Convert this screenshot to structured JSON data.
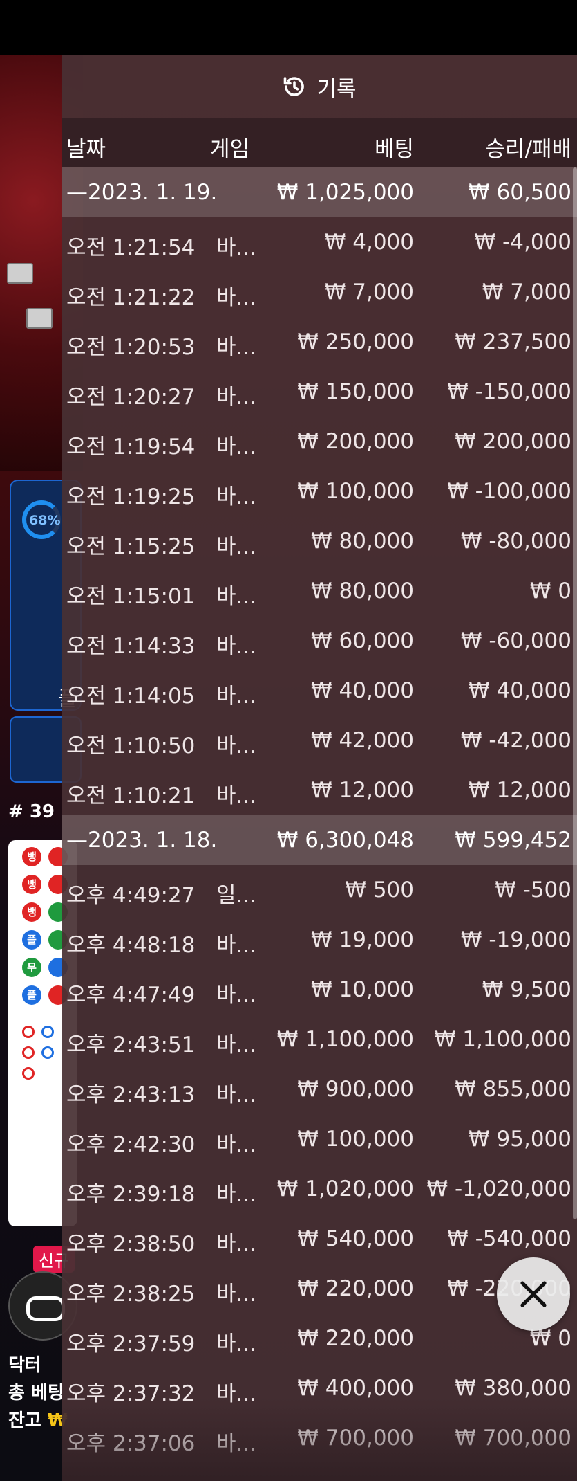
{
  "background": {
    "progress_label": "68%",
    "play_label": "플",
    "round_label": "# 39",
    "roadmap_chars": [
      "뱅",
      "뱅",
      "뱅",
      "플",
      "무",
      "플"
    ],
    "new_badge": "신규",
    "bottom_lines": [
      {
        "prefix": "닥터",
        "label": ""
      },
      {
        "prefix": "총 베팅",
        "label": ""
      },
      {
        "prefix": "잔고",
        "label": "₩"
      }
    ]
  },
  "history": {
    "title": "기록",
    "columns": {
      "date": "날짜",
      "game": "게임",
      "bet": "베팅",
      "result": "승리/패배"
    },
    "groups": [
      {
        "date": "—2023. 1. 19.",
        "bet": "₩ 1,025,000",
        "result": "₩ 60,500",
        "entries": [
          {
            "time": "오전 1:21:54",
            "game": "바...",
            "bet": "₩ 4,000",
            "result": "₩ -4,000"
          },
          {
            "time": "오전 1:21:22",
            "game": "바...",
            "bet": "₩ 7,000",
            "result": "₩ 7,000"
          },
          {
            "time": "오전 1:20:53",
            "game": "바...",
            "bet": "₩ 250,000",
            "result": "₩ 237,500"
          },
          {
            "time": "오전 1:20:27",
            "game": "바...",
            "bet": "₩ 150,000",
            "result": "₩ -150,000"
          },
          {
            "time": "오전 1:19:54",
            "game": "바...",
            "bet": "₩ 200,000",
            "result": "₩ 200,000"
          },
          {
            "time": "오전 1:19:25",
            "game": "바...",
            "bet": "₩ 100,000",
            "result": "₩ -100,000"
          },
          {
            "time": "오전 1:15:25",
            "game": "바...",
            "bet": "₩ 80,000",
            "result": "₩ -80,000"
          },
          {
            "time": "오전 1:15:01",
            "game": "바...",
            "bet": "₩ 80,000",
            "result": "₩ 0"
          },
          {
            "time": "오전 1:14:33",
            "game": "바...",
            "bet": "₩ 60,000",
            "result": "₩ -60,000"
          },
          {
            "time": "오전 1:14:05",
            "game": "바...",
            "bet": "₩ 40,000",
            "result": "₩ 40,000"
          },
          {
            "time": "오전 1:10:50",
            "game": "바...",
            "bet": "₩ 42,000",
            "result": "₩ -42,000"
          },
          {
            "time": "오전 1:10:21",
            "game": "바...",
            "bet": "₩ 12,000",
            "result": "₩ 12,000"
          }
        ]
      },
      {
        "date": "—2023. 1. 18.",
        "bet": "₩ 6,300,048",
        "result": "₩ 599,452",
        "entries": [
          {
            "time": "오후 4:49:27",
            "game": "일...",
            "bet": "₩ 500",
            "result": "₩ -500"
          },
          {
            "time": "오후 4:48:18",
            "game": "바...",
            "bet": "₩ 19,000",
            "result": "₩ -19,000"
          },
          {
            "time": "오후 4:47:49",
            "game": "바...",
            "bet": "₩ 10,000",
            "result": "₩ 9,500"
          },
          {
            "time": "오후 2:43:51",
            "game": "바...",
            "bet": "₩ 1,100,000",
            "result": "₩ 1,100,000"
          },
          {
            "time": "오후 2:43:13",
            "game": "바...",
            "bet": "₩ 900,000",
            "result": "₩ 855,000"
          },
          {
            "time": "오후 2:42:30",
            "game": "바...",
            "bet": "₩ 100,000",
            "result": "₩ 95,000"
          },
          {
            "time": "오후 2:39:18",
            "game": "바...",
            "bet": "₩ 1,020,000",
            "result": "₩ -1,020,000"
          },
          {
            "time": "오후 2:38:50",
            "game": "바...",
            "bet": "₩ 540,000",
            "result": "₩ -540,000"
          },
          {
            "time": "오후 2:38:25",
            "game": "바...",
            "bet": "₩ 220,000",
            "result": "₩ -220,000"
          },
          {
            "time": "오후 2:37:59",
            "game": "바...",
            "bet": "₩ 220,000",
            "result": "₩ 0"
          },
          {
            "time": "오후 2:37:32",
            "game": "바...",
            "bet": "₩ 400,000",
            "result": "₩ 380,000"
          },
          {
            "time": "오후 2:37:06",
            "game": "바...",
            "bet": "₩ 700,000",
            "result": "₩ 700,000"
          }
        ]
      }
    ]
  },
  "icons": {
    "history": "history-clock-icon",
    "close": "close-icon"
  },
  "colors": {
    "panel": "#48302f",
    "group_row": "#6a5356",
    "text": "#f2eaea",
    "roadmap_red": "#e02424",
    "roadmap_blue": "#1e6fe0",
    "roadmap_green": "#1f9a3e"
  }
}
